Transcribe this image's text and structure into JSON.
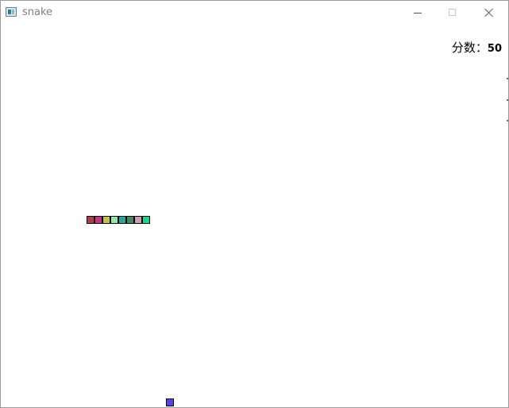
{
  "window": {
    "title": "snake",
    "icon": "app-window-icon"
  },
  "score": {
    "label": "分数：",
    "value": "50"
  },
  "snake": {
    "direction_cell_size": 10,
    "segments": [
      {
        "color": "#b33b47"
      },
      {
        "color": "#c9308a"
      },
      {
        "color": "#c6c23f"
      },
      {
        "color": "#8ce7a8"
      },
      {
        "color": "#27a6a0"
      },
      {
        "color": "#3f8a61"
      },
      {
        "color": "#c9a1b5"
      },
      {
        "color": "#13d78a"
      }
    ]
  },
  "food": {
    "color": "#5e3cf1"
  }
}
